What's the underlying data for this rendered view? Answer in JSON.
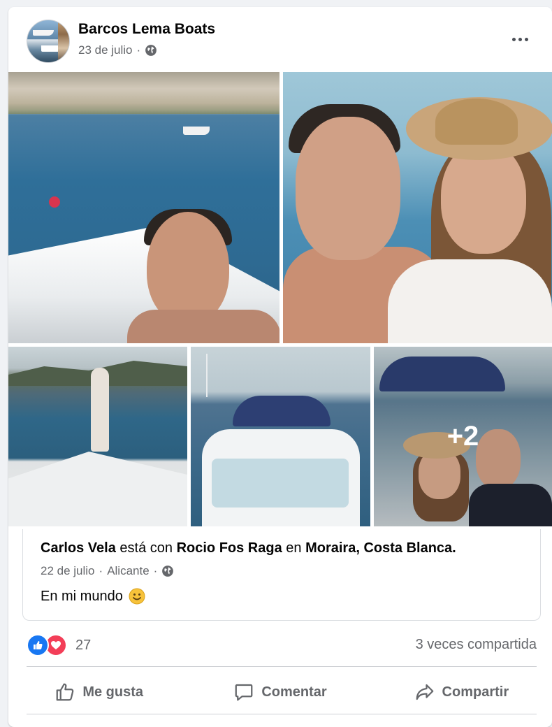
{
  "post": {
    "page_name": "Barcos Lema Boats",
    "date": "23 de julio",
    "more_photos": "+2"
  },
  "shared": {
    "author": "Carlos Vela",
    "with_text": "está con",
    "tagged": "Rocio Fos Raga",
    "in_text": "en",
    "place": "Moraira, Costa Blanca.",
    "date": "22 de julio",
    "separator": "·",
    "location": "Alicante",
    "message": "En mi mundo",
    "emoji": "🙂"
  },
  "stats": {
    "reaction_count": "27",
    "shares": "3 veces compartida",
    "reaction_icons": [
      "like-icon",
      "love-icon"
    ]
  },
  "actions": {
    "like": "Me gusta",
    "comment": "Comentar",
    "share": "Compartir"
  },
  "colors": {
    "like_blue": "#1877f2",
    "love_red": "#f33e58",
    "meta_gray": "#65676b"
  }
}
